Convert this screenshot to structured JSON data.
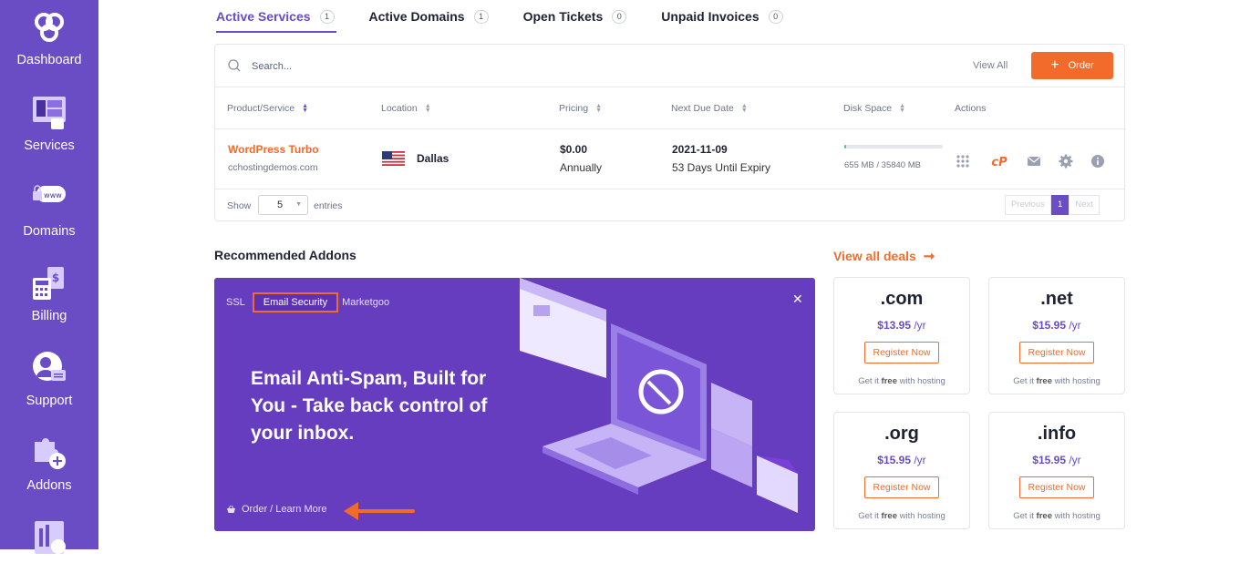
{
  "sidebar": {
    "items": [
      {
        "label": "Dashboard",
        "icon": "cc-logo-icon"
      },
      {
        "label": "Services",
        "icon": "services-icon"
      },
      {
        "label": "Domains",
        "icon": "www-lock-icon"
      },
      {
        "label": "Billing",
        "icon": "billing-calculator-icon"
      },
      {
        "label": "Support",
        "icon": "support-agent-icon"
      },
      {
        "label": "Addons",
        "icon": "puzzle-plus-icon"
      }
    ],
    "color": "#6a4cc4"
  },
  "tabs": [
    {
      "label": "Active Services",
      "count": "1"
    },
    {
      "label": "Active Domains",
      "count": "1"
    },
    {
      "label": "Open Tickets",
      "count": "0"
    },
    {
      "label": "Unpaid Invoices",
      "count": "0"
    }
  ],
  "services": {
    "search_placeholder": "Search...",
    "view_all": "View All",
    "order_label": "Order",
    "columns": [
      "Product/Service",
      "Location",
      "Pricing",
      "Next Due Date",
      "Disk Space",
      "Actions"
    ],
    "row": {
      "product": "WordPress Turbo",
      "domain": "cchostingdemos.com",
      "location": "Dallas",
      "price": "$0.00",
      "cycle": "Annually",
      "due_date": "2021-11-09",
      "expiry": "53 Days Until Expiry",
      "disk_usage": "655 MB / 35840 MB",
      "disk_fraction": 0.018
    },
    "show_label": "Show",
    "entries_value": "5",
    "entries_label": "entries",
    "pager": {
      "prev": "Previous",
      "page": "1",
      "next": "Next"
    }
  },
  "addons": {
    "title": "Recommended Addons",
    "view_deals": "View all deals",
    "banner": {
      "tabs": [
        "SSL",
        "Email Security",
        "Marketgoo"
      ],
      "headline": "Email Anti-Spam, Built for You - Take back control of your inbox.",
      "learn_more": "Order / Learn More"
    },
    "domains": [
      {
        "tld": ".com",
        "price": "$13.95",
        "per": "/yr",
        "button": "Register Now",
        "note_pre": "Get it",
        "note_free": "free",
        "note_post": "with hosting"
      },
      {
        "tld": ".net",
        "price": "$15.95",
        "per": "/yr",
        "button": "Register Now",
        "note_pre": "Get it",
        "note_free": "free",
        "note_post": "with hosting"
      },
      {
        "tld": ".org",
        "price": "$15.95",
        "per": "/yr",
        "button": "Register Now",
        "note_pre": "Get it",
        "note_free": "free",
        "note_post": "with hosting"
      },
      {
        "tld": ".info",
        "price": "$15.95",
        "per": "/yr",
        "button": "Register Now",
        "note_pre": "Get it",
        "note_free": "free",
        "note_post": "with hosting"
      }
    ]
  },
  "colors": {
    "accent": "#6a4cc4",
    "orange": "#f26b2a",
    "banner": "#673dbf"
  }
}
